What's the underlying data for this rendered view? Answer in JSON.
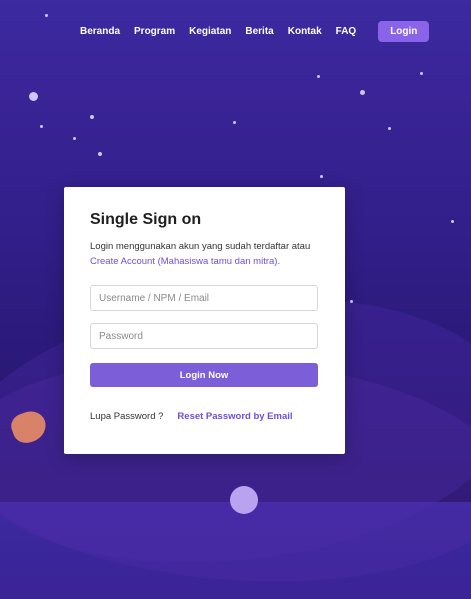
{
  "nav": {
    "items": [
      "Beranda",
      "Program",
      "Kegiatan",
      "Berita",
      "Kontak",
      "FAQ"
    ],
    "login_label": "Login"
  },
  "card": {
    "title": "Single Sign on",
    "description": "Login menggunakan akun yang sudah terdaftar atau",
    "create_account_link": "Create Account (Mahasiswa tamu dan mitra).",
    "username_placeholder": "Username / NPM / Email",
    "password_placeholder": "Password",
    "submit_label": "Login Now",
    "forgot_label": "Lupa Password ?",
    "reset_link": "Reset Password by Email"
  },
  "colors": {
    "accent": "#7c5ed9",
    "nav_button": "#8a64e8",
    "background": "#32208c"
  }
}
